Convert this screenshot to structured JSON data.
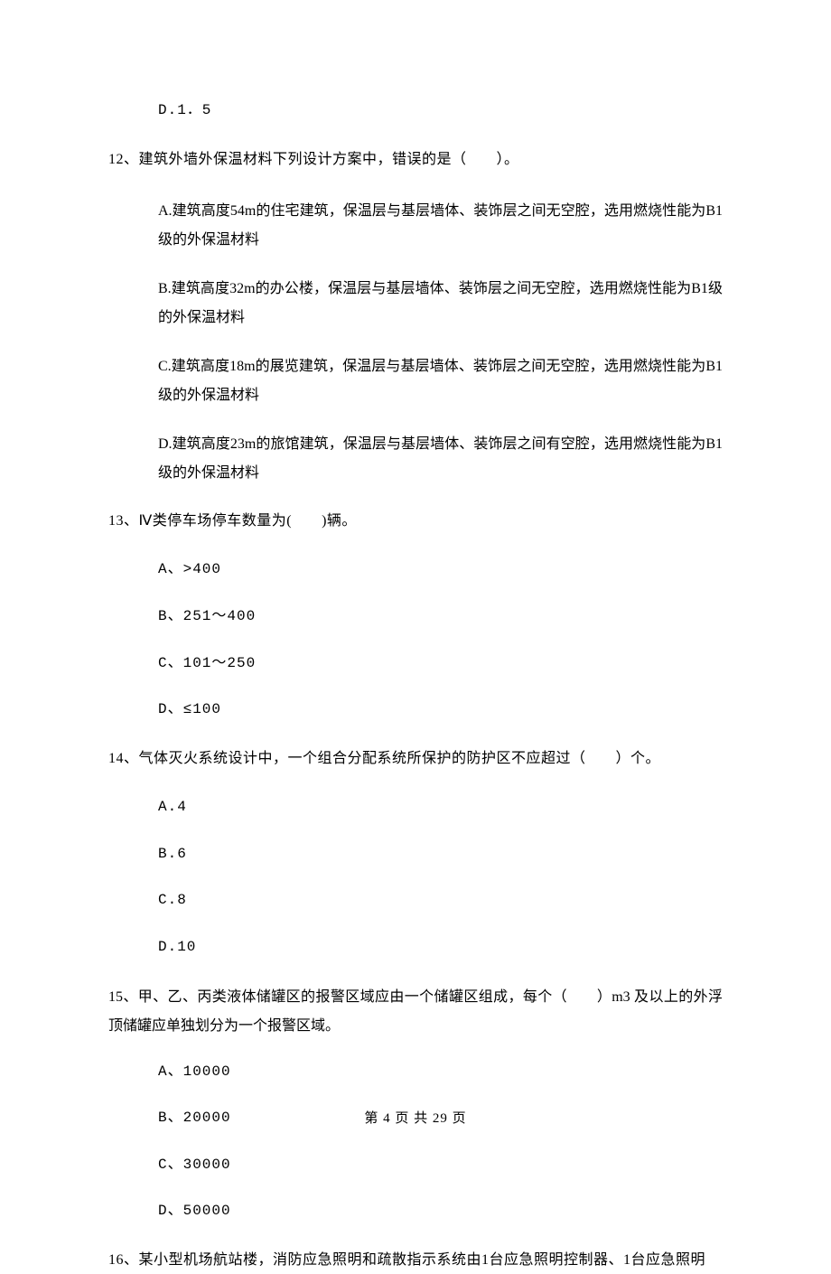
{
  "q11": {
    "optD": "D.1．5"
  },
  "q12": {
    "stem": "12、建筑外墙外保温材料下列设计方案中，错误的是（　　）。",
    "optA": "A.建筑高度54m的住宅建筑，保温层与基层墙体、装饰层之间无空腔，选用燃烧性能为B1级的外保温材料",
    "optB": "B.建筑高度32m的办公楼，保温层与基层墙体、装饰层之间无空腔，选用燃烧性能为B1级的外保温材料",
    "optC": "C.建筑高度18m的展览建筑，保温层与基层墙体、装饰层之间无空腔，选用燃烧性能为B1级的外保温材料",
    "optD": "D.建筑高度23m的旅馆建筑，保温层与基层墙体、装饰层之间有空腔，选用燃烧性能为B1级的外保温材料"
  },
  "q13": {
    "stem": "13、Ⅳ类停车场停车数量为(　　)辆。",
    "optA": "A、>400",
    "optB": "B、251～400",
    "optC": "C、101～250",
    "optD": "D、≤100"
  },
  "q14": {
    "stem": "14、气体灭火系统设计中，一个组合分配系统所保护的防护区不应超过（　　）个。",
    "optA": "A.4",
    "optB": "B.6",
    "optC": "C.8",
    "optD": "D.10"
  },
  "q15": {
    "stem": "15、甲、乙、丙类液体储罐区的报警区域应由一个储罐区组成，每个（　　）m3 及以上的外浮顶储罐应单独划分为一个报警区域。",
    "optA": "A、10000",
    "optB": "B、20000",
    "optC": "C、30000",
    "optD": "D、50000"
  },
  "q16": {
    "stem": "16、某小型机场航站楼，消防应急照明和疏散指示系统由1台应急照明控制器、1台应急照明"
  },
  "footer": "第 4 页 共 29 页"
}
